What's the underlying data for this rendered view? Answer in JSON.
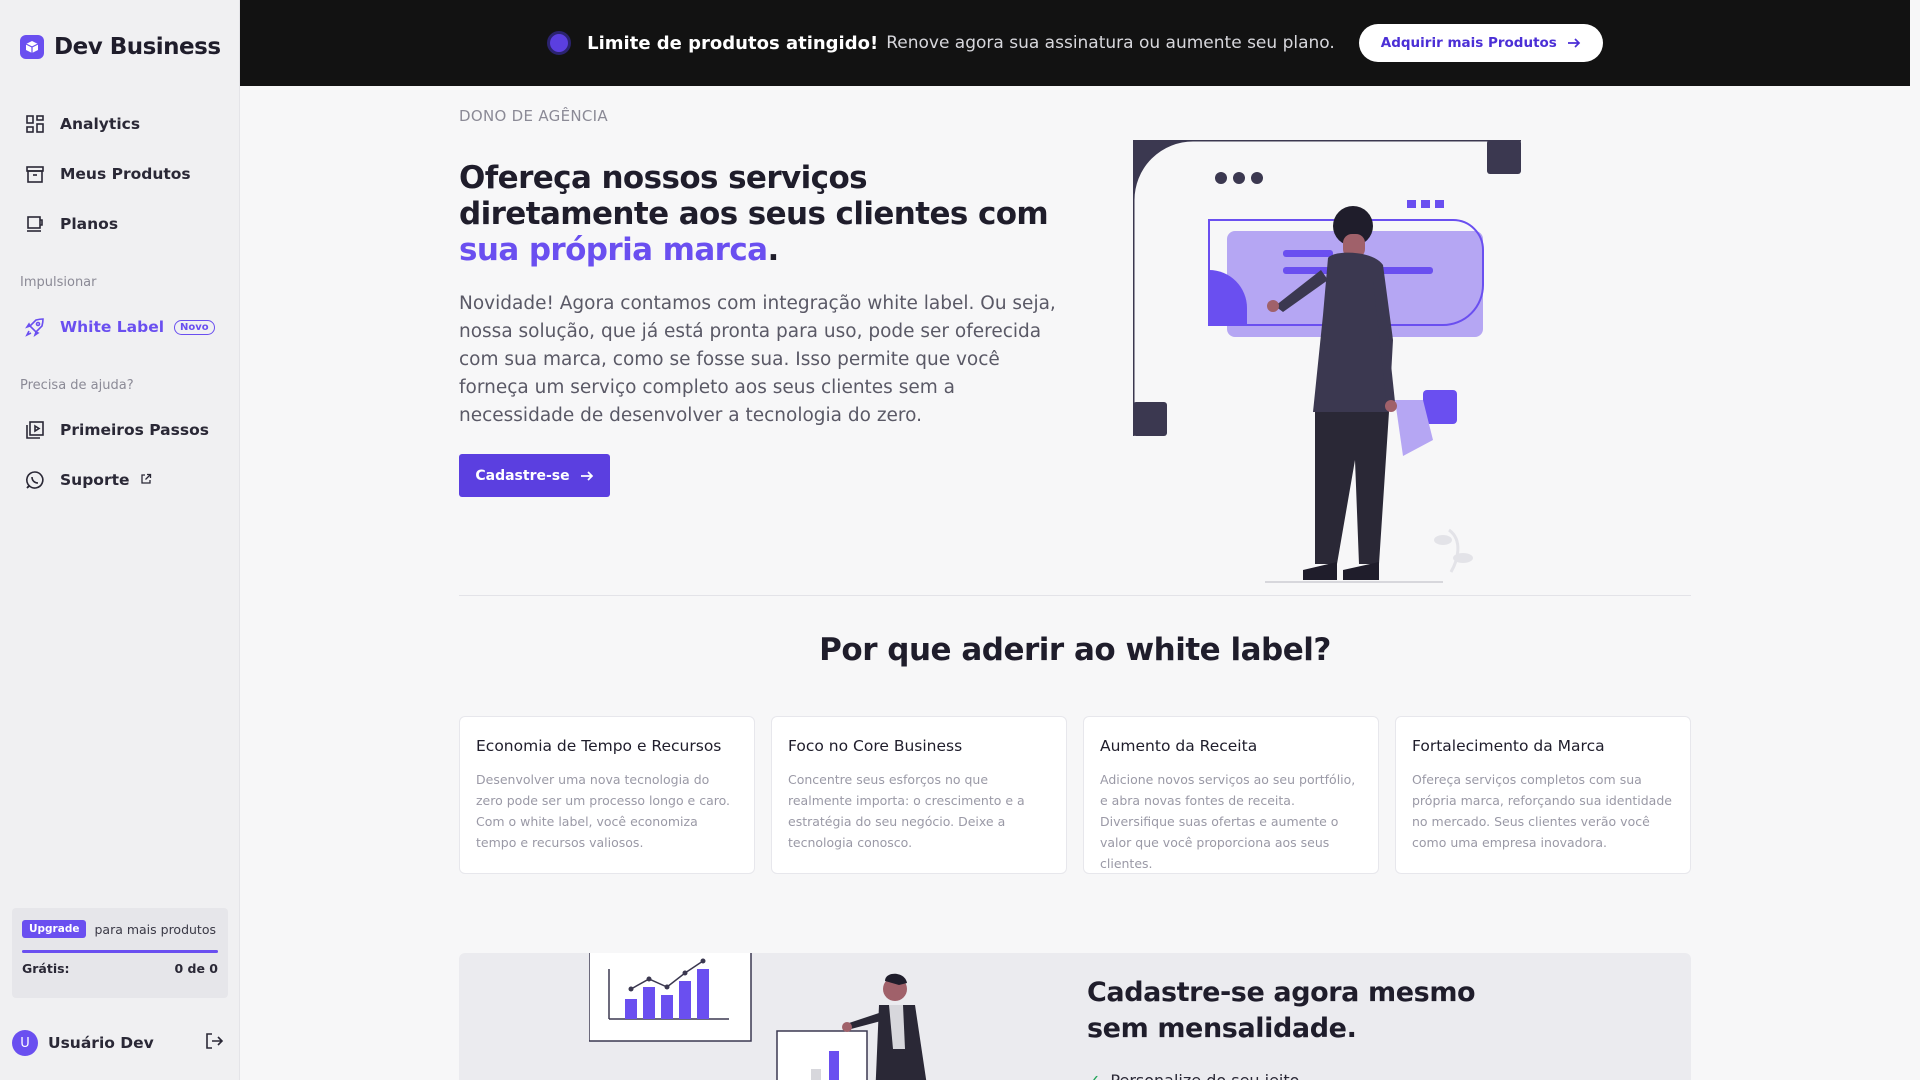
{
  "brand": {
    "name": "Dev Business",
    "logo_icon": "box-icon",
    "accent": "#6a4ff0"
  },
  "sidebar": {
    "items": [
      {
        "label": "Analytics",
        "icon": "grid-icon"
      },
      {
        "label": "Meus Produtos",
        "icon": "archive-icon"
      },
      {
        "label": "Planos",
        "icon": "cup-icon"
      }
    ],
    "section_boost": "Impulsionar",
    "white_label": {
      "label": "White Label",
      "badge": "Novo",
      "icon": "rocket-icon"
    },
    "section_help": "Precisa de ajuda?",
    "help_items": [
      {
        "label": "Primeiros Passos",
        "icon": "play-book-icon"
      },
      {
        "label": "Suporte",
        "icon": "whatsapp-icon"
      }
    ],
    "upgrade": {
      "button": "Upgrade",
      "text": "para mais produtos",
      "plan_label": "Grátis:",
      "usage": "0 de 0",
      "usage_fraction": 1.0
    },
    "user": {
      "initial": "U",
      "name": "Usuário Dev"
    }
  },
  "banner": {
    "strong": "Limite de produtos atingido!",
    "text": "Renove agora sua assinatura ou aumente seu plano.",
    "button": "Adquirir mais Produtos"
  },
  "hero": {
    "eyebrow": "DONO DE AGÊNCIA",
    "title_part1": "Ofereça nossos serviços diretamente aos seus clientes com ",
    "title_accent": "sua própria marca",
    "title_end": ".",
    "description": "Novidade! Agora contamos com integração white label. Ou seja, nossa solução, que já está pronta para uso, pode ser oferecida com sua marca, como se fosse sua. Isso permite que você forneça um serviço completo aos seus clientes sem a necessidade de desenvolver a tecnologia do zero.",
    "cta": "Cadastre-se"
  },
  "why": {
    "title": "Por que aderir ao white label?",
    "cards": [
      {
        "title": "Economia de Tempo e Recursos",
        "text": "Desenvolver uma nova tecnologia do zero pode ser um processo longo e caro. Com o white label, você economiza tempo e recursos valiosos."
      },
      {
        "title": "Foco no Core Business",
        "text": "Concentre seus esforços no que realmente importa: o crescimento e a estratégia do seu negócio. Deixe a tecnologia conosco."
      },
      {
        "title": "Aumento da Receita",
        "text": "Adicione novos serviços ao seu portfólio, e abra novas fontes de receita. Diversifique suas ofertas e aumente o valor que você proporciona aos seus clientes."
      },
      {
        "title": "Fortalecimento da Marca",
        "text": "Ofereça serviços completos com sua própria marca, reforçando sua identidade no mercado. Seus clientes verão você como uma empresa inovadora."
      }
    ]
  },
  "signup": {
    "title": "Cadastre-se agora mesmo sem mensalidade.",
    "first_item": "Personalize do seu jeito"
  }
}
